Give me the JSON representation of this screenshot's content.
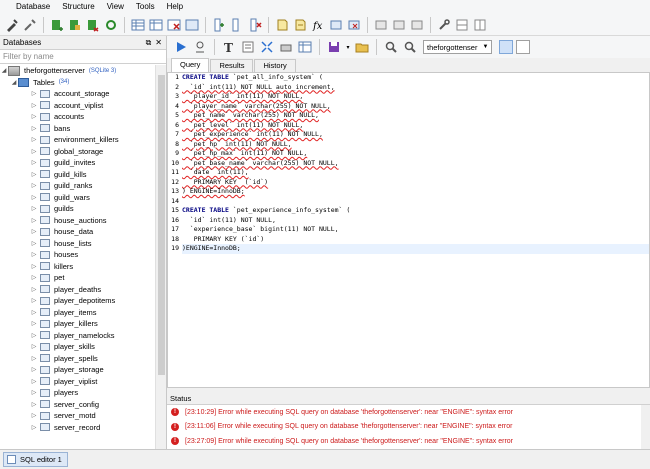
{
  "menu": [
    "Database",
    "Structure",
    "View",
    "Tools",
    "Help"
  ],
  "left_pane": {
    "title": "Databases",
    "filter_placeholder": "Filter by name",
    "server": {
      "name": "theforgottenserver",
      "badge": "(SQLite 3)"
    },
    "tables_node": {
      "label": "Tables",
      "badge": "(34)"
    },
    "tables": [
      "account_storage",
      "account_viplist",
      "accounts",
      "bans",
      "environment_killers",
      "global_storage",
      "guild_invites",
      "guild_kills",
      "guild_ranks",
      "guild_wars",
      "guilds",
      "house_auctions",
      "house_data",
      "house_lists",
      "houses",
      "killers",
      "pet",
      "player_deaths",
      "player_depotitems",
      "player_items",
      "player_killers",
      "player_namelocks",
      "player_skills",
      "player_spells",
      "player_storage",
      "player_viplist",
      "players",
      "server_config",
      "server_motd",
      "server_record"
    ]
  },
  "editor_toolbar": {
    "database": "theforgottenser"
  },
  "tabs": [
    "Query",
    "Results",
    "History"
  ],
  "code_lines": [
    {
      "kw": "CREATE TABLE",
      "rest": " `pet_all_info_system` (",
      "err": false
    },
    {
      "kw": "",
      "rest": "  `id` int(11) NOT NULL auto_increment,",
      "err": true
    },
    {
      "kw": "",
      "rest": "  `player_id` int(11) NOT NULL,",
      "err": true
    },
    {
      "kw": "",
      "rest": "  `player_name` varchar(255) NOT NULL,",
      "err": true
    },
    {
      "kw": "",
      "rest": "  `pet_name` varchar(255) NOT NULL,",
      "err": true
    },
    {
      "kw": "",
      "rest": "  `pet_level` int(11) NOT NULL,",
      "err": true
    },
    {
      "kw": "",
      "rest": "  `pet_experience` int(11) NOT NULL,",
      "err": true
    },
    {
      "kw": "",
      "rest": "  `pet_hp` int(11) NOT NULL,",
      "err": true
    },
    {
      "kw": "",
      "rest": "  `pet_hp_max` int(11) NOT NULL,",
      "err": true
    },
    {
      "kw": "",
      "rest": "  `pet_base_name` varchar(255) NOT NULL,",
      "err": true
    },
    {
      "kw": "",
      "rest": "  `date` int(11),",
      "err": true
    },
    {
      "kw": "",
      "rest": "   PRIMARY KEY  (`id`)",
      "err": true
    },
    {
      "kw": "",
      "rest": ") ENGINE=InnoDB;",
      "err": true
    },
    {
      "kw": "",
      "rest": "",
      "err": false
    },
    {
      "kw": "CREATE TABLE",
      "rest": " `pet_experience_info_system` (",
      "err": false
    },
    {
      "kw": "",
      "rest": "  `id` int(11) NOT NULL,",
      "err": false
    },
    {
      "kw": "",
      "rest": "  `experience_base` bigint(11) NOT NULL,",
      "err": false
    },
    {
      "kw": "",
      "rest": "   PRIMARY KEY (`id`)",
      "err": false
    },
    {
      "kw": "",
      "rest": ")ENGINE=InnoDB;",
      "err": false
    }
  ],
  "status": {
    "title": "Status",
    "rows": [
      "[23:10:29]  Error while executing SQL query on database 'theforgottenserver': near \"ENGINE\": syntax error",
      "[23:11:06]  Error while executing SQL query on database 'theforgottenserver': near \"ENGINE\": syntax error",
      "[23:27:09]  Error while executing SQL query on database 'theforgottenserver': near \"ENGINE\": syntax error"
    ]
  },
  "bottom_tab": "SQL editor 1",
  "colors": {
    "error": "#cc1a1a",
    "keyword": "#000080",
    "accent": "#3060c0"
  }
}
